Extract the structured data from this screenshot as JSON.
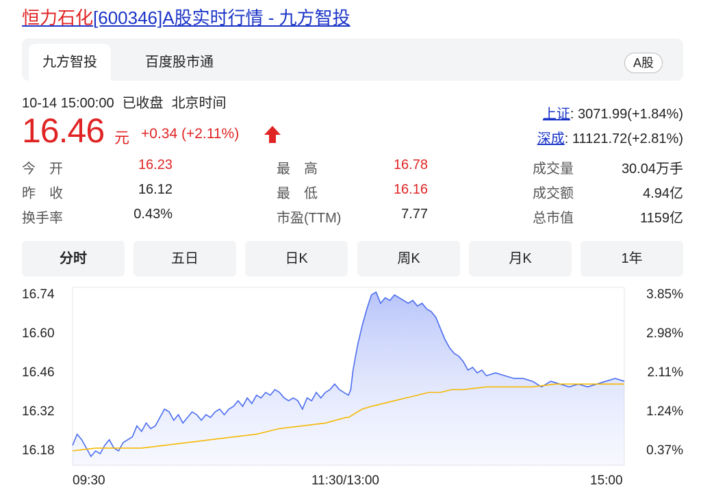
{
  "page": {
    "title_name": "恒力石化",
    "title_rest": "[600346]A股实时行情 - 九方智投"
  },
  "tabs": [
    {
      "label": "九方智投",
      "active": true
    },
    {
      "label": "百度股市通",
      "active": false
    }
  ],
  "market_badge": "A股",
  "quote": {
    "datetime": "10-14 15:00:00",
    "status": "已收盘",
    "timezone": "北京时间",
    "price": "16.46",
    "unit": "元",
    "change": "+0.34 (+2.11%)",
    "direction_icon": "up-arrow-icon",
    "up_color": "#e02424"
  },
  "indices": [
    {
      "label": "上证",
      "value": ": 3071.99(+1.84%)"
    },
    {
      "label": "深成",
      "value": ": 11121.72(+2.81%)"
    }
  ],
  "stats": {
    "col1": [
      {
        "label": "今　开",
        "value": "16.23",
        "red": true
      },
      {
        "label": "昨　收",
        "value": "16.12",
        "red": false
      },
      {
        "label": "换手率",
        "value": "0.43%",
        "red": false
      }
    ],
    "col2": [
      {
        "label": "最　高",
        "value": "16.78",
        "red": true
      },
      {
        "label": "最　低",
        "value": "16.16",
        "red": true
      },
      {
        "label": "市盈(TTM)",
        "value": "7.77",
        "red": false
      }
    ],
    "col3": [
      {
        "label": "成交量",
        "value": "30.04万手",
        "red": false
      },
      {
        "label": "成交额",
        "value": "4.94亿",
        "red": false
      },
      {
        "label": "总市值",
        "value": "1159亿",
        "red": false
      }
    ]
  },
  "periods": [
    {
      "label": "分时",
      "active": true
    },
    {
      "label": "五日",
      "active": false
    },
    {
      "label": "日K",
      "active": false
    },
    {
      "label": "周K",
      "active": false
    },
    {
      "label": "月K",
      "active": false
    },
    {
      "label": "1年",
      "active": false
    }
  ],
  "chart_data": {
    "type": "line",
    "y_left_ticks": [
      "16.74",
      "16.60",
      "16.46",
      "16.32",
      "16.18"
    ],
    "y_right_ticks": [
      "3.85%",
      "2.98%",
      "2.11%",
      "1.24%",
      "0.37%"
    ],
    "x_ticks": [
      "09:30",
      "11:30/13:00",
      "15:00"
    ],
    "ylim": [
      16.12,
      16.78
    ],
    "x_minutes": 240,
    "price_color": "#4a6cf0",
    "avg_color": "#f5b800",
    "series": [
      {
        "role": "price",
        "x": [
          0,
          2,
          4,
          6,
          8,
          10,
          12,
          14,
          16,
          18,
          20,
          22,
          24,
          26,
          28,
          30,
          32,
          34,
          36,
          38,
          40,
          42,
          44,
          46,
          48,
          50,
          52,
          54,
          56,
          58,
          60,
          62,
          64,
          66,
          68,
          70,
          72,
          74,
          76,
          78,
          80,
          82,
          84,
          86,
          88,
          90,
          92,
          94,
          96,
          98,
          100,
          102,
          104,
          106,
          108,
          110,
          112,
          114,
          116,
          118,
          120,
          121,
          122,
          124,
          126,
          128,
          130,
          132,
          134,
          136,
          138,
          140,
          142,
          144,
          146,
          148,
          150,
          152,
          154,
          156,
          158,
          160,
          162,
          164,
          166,
          168,
          170,
          172,
          174,
          176,
          178,
          180,
          184,
          188,
          192,
          196,
          200,
          204,
          208,
          212,
          216,
          220,
          224,
          228,
          232,
          236,
          240
        ],
        "y": [
          16.2,
          16.24,
          16.22,
          16.19,
          16.16,
          16.18,
          16.17,
          16.2,
          16.22,
          16.19,
          16.18,
          16.21,
          16.22,
          16.23,
          16.27,
          16.25,
          16.28,
          16.26,
          16.27,
          16.3,
          16.33,
          16.32,
          16.29,
          16.31,
          16.28,
          16.3,
          16.32,
          16.31,
          16.29,
          16.31,
          16.3,
          16.32,
          16.33,
          16.31,
          16.33,
          16.34,
          16.36,
          16.34,
          16.37,
          16.35,
          16.38,
          16.37,
          16.39,
          16.38,
          16.4,
          16.39,
          16.37,
          16.36,
          16.37,
          16.36,
          16.33,
          16.37,
          16.36,
          16.39,
          16.37,
          16.39,
          16.4,
          16.42,
          16.4,
          16.39,
          16.38,
          16.4,
          16.47,
          16.56,
          16.63,
          16.69,
          16.74,
          16.75,
          16.71,
          16.73,
          16.72,
          16.74,
          16.73,
          16.72,
          16.71,
          16.72,
          16.7,
          16.71,
          16.69,
          16.68,
          16.66,
          16.62,
          16.58,
          16.55,
          16.53,
          16.52,
          16.5,
          16.47,
          16.48,
          16.46,
          16.47,
          16.45,
          16.46,
          16.45,
          16.44,
          16.44,
          16.43,
          16.41,
          16.43,
          16.42,
          16.41,
          16.42,
          16.41,
          16.42,
          16.43,
          16.44,
          16.43
        ]
      },
      {
        "role": "average",
        "x": [
          0,
          10,
          20,
          30,
          40,
          50,
          60,
          70,
          80,
          90,
          100,
          110,
          119,
          120,
          122,
          126,
          130,
          135,
          140,
          145,
          150,
          155,
          160,
          165,
          170,
          180,
          190,
          200,
          210,
          220,
          230,
          240
        ],
        "y": [
          16.18,
          16.19,
          16.19,
          16.19,
          16.2,
          16.21,
          16.22,
          16.23,
          16.24,
          16.26,
          16.27,
          16.28,
          16.3,
          16.3,
          16.31,
          16.33,
          16.34,
          16.35,
          16.36,
          16.37,
          16.38,
          16.39,
          16.39,
          16.4,
          16.4,
          16.41,
          16.41,
          16.41,
          16.42,
          16.42,
          16.42,
          16.42
        ]
      }
    ]
  }
}
